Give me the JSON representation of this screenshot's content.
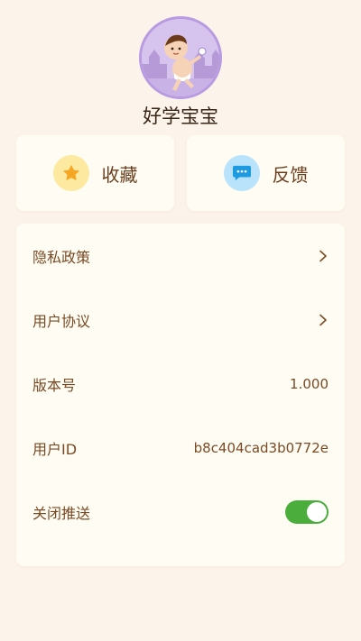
{
  "profile": {
    "username": "好学宝宝"
  },
  "quick_actions": [
    {
      "label": "收藏",
      "icon": "star-icon"
    },
    {
      "label": "反馈",
      "icon": "chat-bubble-icon"
    }
  ],
  "settings": {
    "privacy_label": "隐私政策",
    "agreement_label": "用户协议",
    "version_label": "版本号",
    "version_value": "1.000",
    "user_id_label": "用户ID",
    "user_id_value": "b8c404cad3b0772e",
    "push_label": "关闭推送",
    "push_enabled": true
  },
  "colors": {
    "background": "#fcf3ea",
    "card": "#fffdf3",
    "text": "#7a4a24",
    "toggle_on": "#4bae3c",
    "star_bg": "#fde9a0",
    "chat_bg": "#b9e3fb"
  }
}
